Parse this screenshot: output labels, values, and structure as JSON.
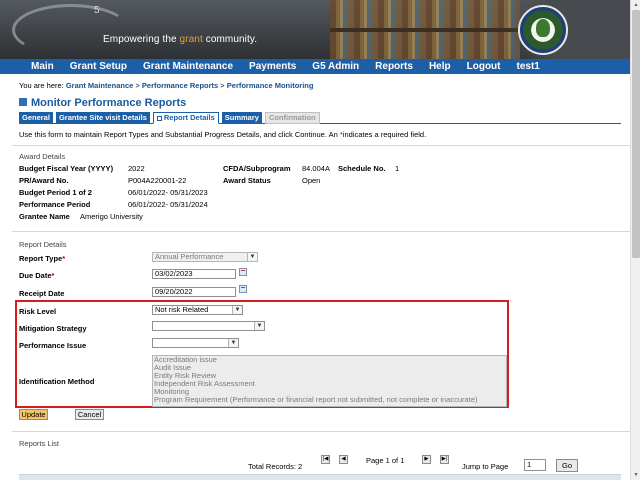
{
  "banner": {
    "logo_superscript": "5",
    "tagline_before": "Empowering the ",
    "tagline_highlight": "grant",
    "tagline_after": " community."
  },
  "nav": {
    "items": [
      "Main",
      "Grant Setup",
      "Grant Maintenance",
      "Payments",
      "G5 Admin",
      "Reports",
      "Help",
      "Logout",
      "test1"
    ]
  },
  "breadcrumb": {
    "prefix": "You are here: ",
    "items": [
      "Grant Maintenance",
      "Performance Reports",
      "Performance Monitoring"
    ],
    "separator": " > "
  },
  "page_title": "Monitor Performance Reports",
  "tabs": [
    {
      "label": "General",
      "state": "normal"
    },
    {
      "label": "Grantee Site visit Details",
      "state": "normal"
    },
    {
      "label": "Report Details",
      "state": "active"
    },
    {
      "label": "Summary",
      "state": "normal"
    },
    {
      "label": "Confirmation",
      "state": "disabled"
    }
  ],
  "instructions": {
    "text": "Use this form to maintain Report Types and Substantial Progress Details, and click Continue.   An ",
    "star": "*",
    "after": "indicates a required field."
  },
  "award_details": {
    "section_label": "Award Details",
    "budget_fiscal_year_label": "Budget Fiscal Year (YYYY)",
    "budget_fiscal_year_value": "2022",
    "cfda_label": "CFDA/Subprogram",
    "cfda_value": "84.004A",
    "schedule_label": "Schedule No.",
    "schedule_value": "1",
    "pr_award_label": "PR/Award No.",
    "pr_award_value": "P004A220001-22",
    "award_status_label": "Award Status",
    "award_status_value": "Open",
    "budget_period_label": "Budget Period   1  of  2",
    "budget_period_value": "06/01/2022- 05/31/2023",
    "performance_period_label": "Performance Period",
    "performance_period_value": "06/01/2022- 05/31/2024",
    "grantee_name_label": "Grantee Name",
    "grantee_name_value": "Amerigo University"
  },
  "report_details": {
    "section_label": "Report Details",
    "report_type_label": "Report Type",
    "report_type_value": "Annual Performance",
    "due_date_label": "Due Date",
    "due_date_value": "03/02/2023",
    "receipt_date_label": "Receipt Date",
    "receipt_date_value": "09/20/2022",
    "required_star": "*",
    "risk_level_label": "Risk Level",
    "risk_level_value": "Not risk Related",
    "mitigation_label": "Mitigation Strategy",
    "mitigation_value": "",
    "performance_issue_label": "Performance Issue",
    "performance_issue_value": "",
    "identification_method_label": "Identification Method",
    "identification_methods": [
      "Accreditation issue",
      "Audit Issue",
      "Entity Risk Review",
      "Independent Risk Assessment",
      "Monitoring",
      "Program Requirement (Performance or financial report not submitted, not complete or inaccurate)"
    ]
  },
  "buttons": {
    "update": "Update",
    "cancel": "Cancel"
  },
  "reports_list": {
    "section_label": "Reports List",
    "total_records": "Total Records: 2",
    "page_text": "Page 1 of 1",
    "jump_label": "Jump to Page",
    "jump_value": "1",
    "go": "Go"
  },
  "icons": {
    "first": "first-page-icon",
    "prev": "prev-page-icon",
    "next": "next-page-icon",
    "last": "last-page-icon",
    "calendar": "calendar-icon"
  },
  "colors": {
    "nav_bg": "#1d5fa6",
    "title": "#1a5a9e",
    "highlight_box": "#d11e1e",
    "required": "#c00000",
    "update_button": "#f5c46a"
  }
}
